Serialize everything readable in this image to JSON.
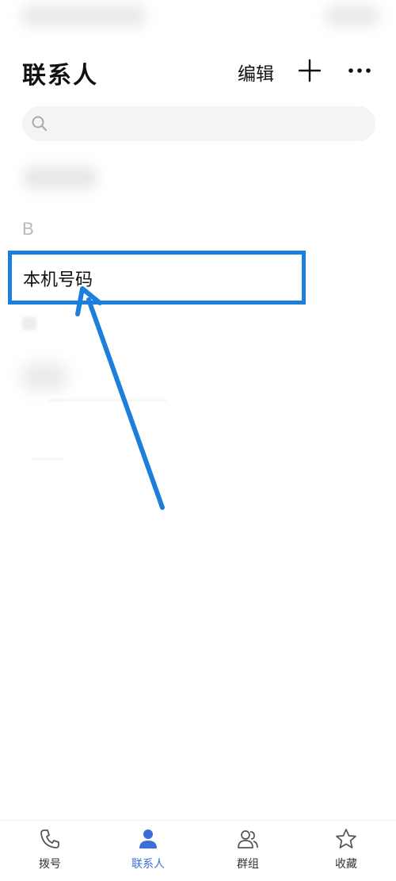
{
  "header": {
    "title": "联系人",
    "edit_label": "编辑",
    "add_icon": "plus-icon",
    "more_icon": "more-dots-icon"
  },
  "search": {
    "placeholder": "",
    "icon": "search-icon"
  },
  "contacts": {
    "section_letter": "B",
    "highlighted_item": "本机号码"
  },
  "annotation": {
    "highlight_color": "#1c7fdc",
    "arrow_color": "#1c7fdc"
  },
  "bottom_nav": [
    {
      "label": "拨号",
      "icon": "phone-icon",
      "active": false
    },
    {
      "label": "联系人",
      "icon": "person-icon",
      "active": true
    },
    {
      "label": "群组",
      "icon": "group-icon",
      "active": false
    },
    {
      "label": "收藏",
      "icon": "star-icon",
      "active": false
    }
  ],
  "colors": {
    "accent": "#3a6fd8"
  }
}
